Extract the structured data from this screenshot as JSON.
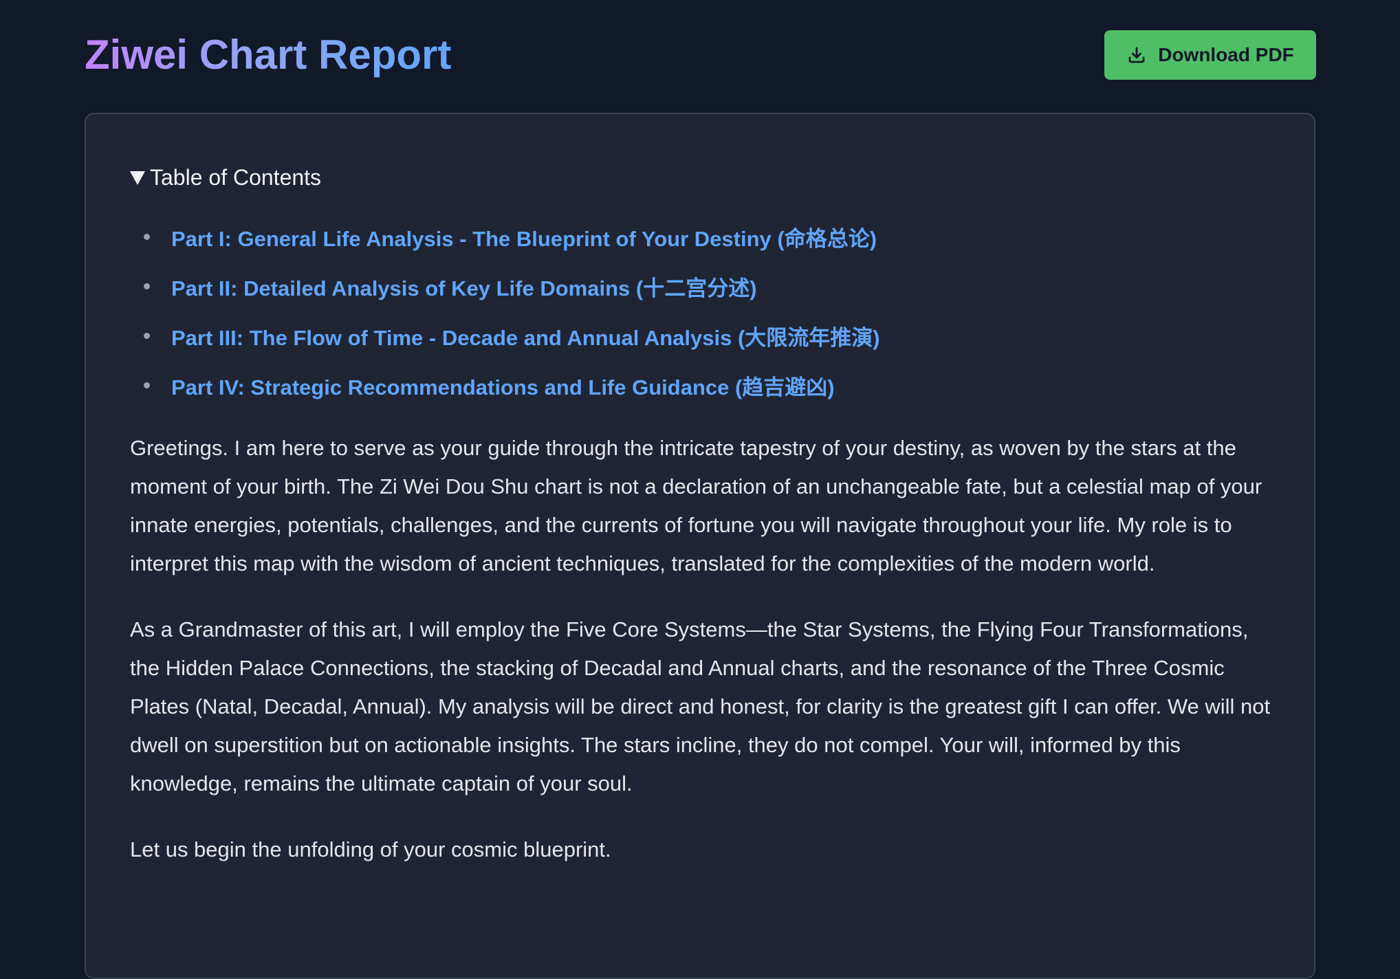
{
  "header": {
    "title": "Ziwei Chart Report",
    "download_label": "Download PDF",
    "download_icon": "download-icon"
  },
  "colors": {
    "background": "#111827",
    "card": "#1e2433",
    "accent_link": "#60a5fa",
    "button": "#4fbf67",
    "title_gradient_start": "#c084fc",
    "title_gradient_end": "#60a5fa"
  },
  "toc": {
    "label": "Table of Contents",
    "expanded": true,
    "items": [
      {
        "label": "Part I: General Life Analysis - The Blueprint of Your Destiny (命格总论)"
      },
      {
        "label": "Part II: Detailed Analysis of Key Life Domains (十二宫分述)"
      },
      {
        "label": "Part III: The Flow of Time - Decade and Annual Analysis (大限流年推演)"
      },
      {
        "label": "Part IV: Strategic Recommendations and Life Guidance (趋吉避凶)"
      }
    ]
  },
  "body": {
    "paragraphs": [
      "Greetings. I am here to serve as your guide through the intricate tapestry of your destiny, as woven by the stars at the moment of your birth. The Zi Wei Dou Shu chart is not a declaration of an unchangeable fate, but a celestial map of your innate energies, potentials, challenges, and the currents of fortune you will navigate throughout your life. My role is to interpret this map with the wisdom of ancient techniques, translated for the complexities of the modern world.",
      "As a Grandmaster of this art, I will employ the Five Core Systems—the Star Systems, the Flying Four Transformations, the Hidden Palace Connections, the stacking of Decadal and Annual charts, and the resonance of the Three Cosmic Plates (Natal, Decadal, Annual). My analysis will be direct and honest, for clarity is the greatest gift I can offer. We will not dwell on superstition but on actionable insights. The stars incline, they do not compel. Your will, informed by this knowledge, remains the ultimate captain of your soul.",
      "Let us begin the unfolding of your cosmic blueprint."
    ]
  }
}
